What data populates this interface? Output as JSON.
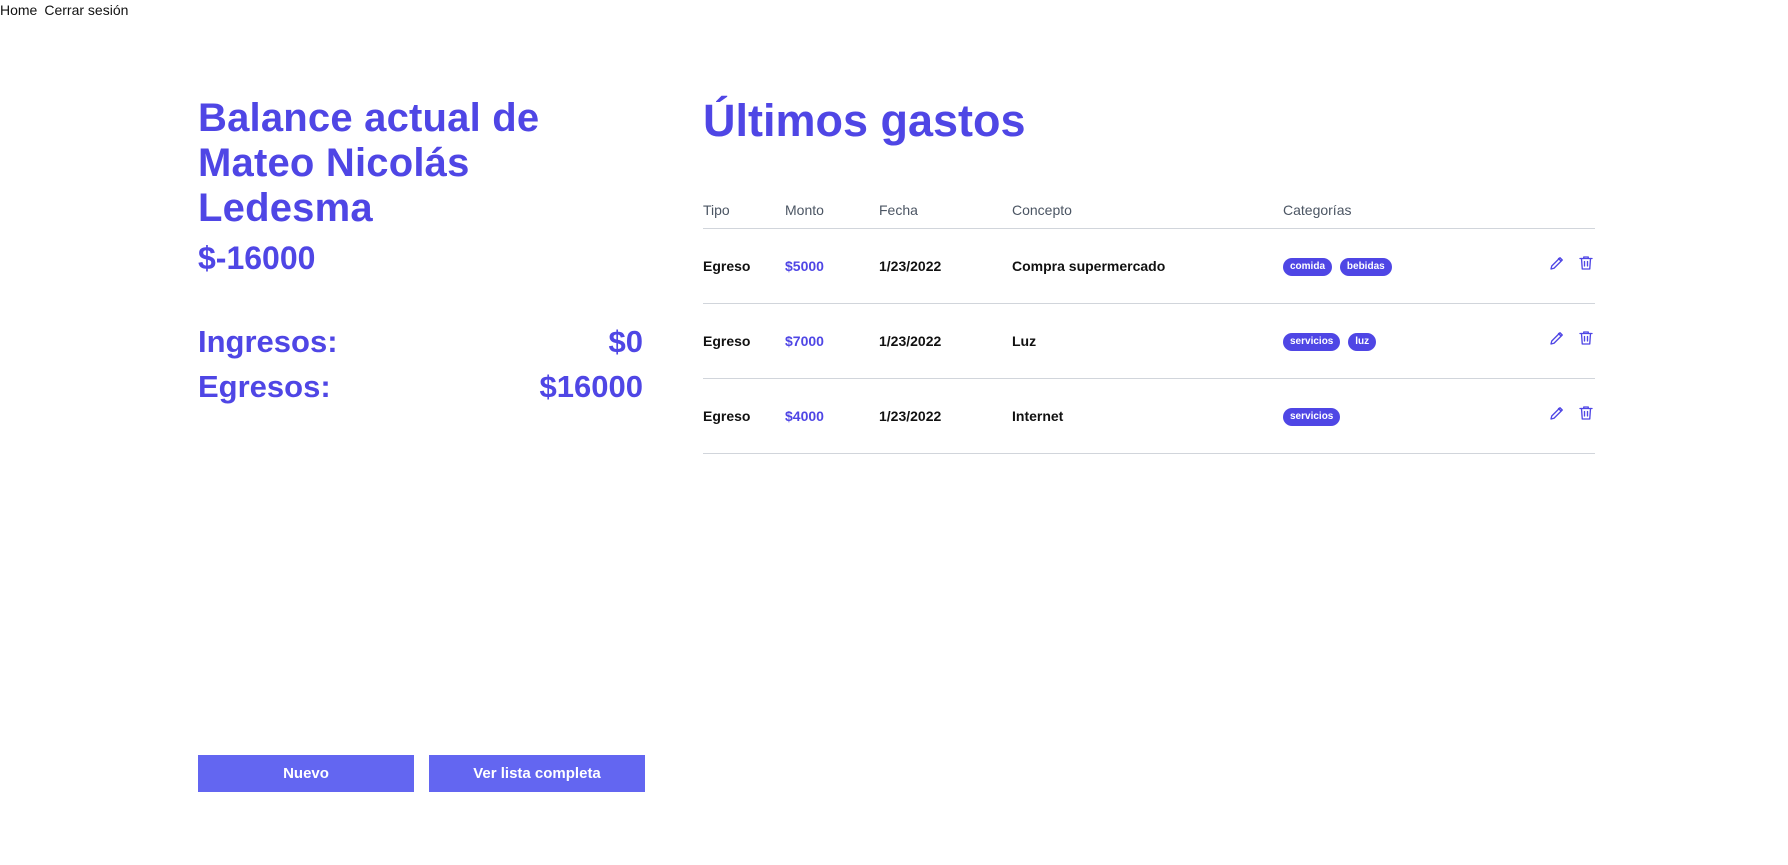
{
  "nav": {
    "home": "Home",
    "logout": "Cerrar sesión"
  },
  "balance": {
    "title": "Balance actual de Mateo Nicolás Ledesma",
    "amount": "$-16000",
    "income_label": "Ingresos:",
    "income_value": "$0",
    "expense_label": "Egresos:",
    "expense_value": "$16000"
  },
  "buttons": {
    "new": "Nuevo",
    "full_list": "Ver lista completa"
  },
  "expenses": {
    "title": "Últimos gastos",
    "headers": [
      "Tipo",
      "Monto",
      "Fecha",
      "Concepto",
      "Categorías"
    ],
    "rows": [
      {
        "tipo": "Egreso",
        "monto": "$5000",
        "fecha": "1/23/2022",
        "concepto": "Compra supermercado",
        "categorias": [
          "comida",
          "bebidas"
        ]
      },
      {
        "tipo": "Egreso",
        "monto": "$7000",
        "fecha": "1/23/2022",
        "concepto": "Luz",
        "categorias": [
          "servicios",
          "luz"
        ]
      },
      {
        "tipo": "Egreso",
        "monto": "$4000",
        "fecha": "1/23/2022",
        "concepto": "Internet",
        "categorias": [
          "servicios"
        ]
      }
    ]
  },
  "colors": {
    "accent": "#4f46e5",
    "button": "#6366f1",
    "divider": "#d1d5db"
  },
  "icons": {
    "edit": "pencil-icon",
    "delete": "trash-icon"
  }
}
